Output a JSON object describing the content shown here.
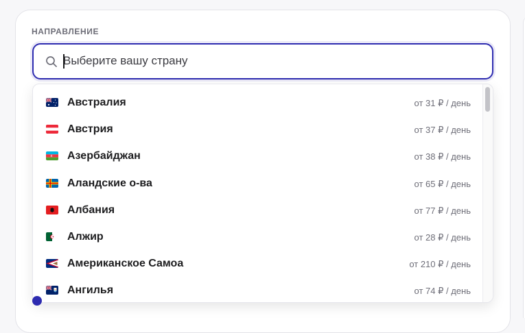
{
  "section": {
    "label": "НАПРАВЛЕНИЕ"
  },
  "search": {
    "placeholder": "Выберите вашу страну",
    "value": ""
  },
  "countries": [
    {
      "name": "Австралия",
      "price": "от 31 ₽ / день",
      "flag_icon": "flag-australia-icon"
    },
    {
      "name": "Австрия",
      "price": "от 37 ₽ / день",
      "flag_icon": "flag-austria-icon"
    },
    {
      "name": "Азербайджан",
      "price": "от 38 ₽ / день",
      "flag_icon": "flag-azerbaijan-icon"
    },
    {
      "name": "Аландские о-ва",
      "price": "от 65 ₽ / день",
      "flag_icon": "flag-aland-islands-icon"
    },
    {
      "name": "Албания",
      "price": "от 77 ₽ / день",
      "flag_icon": "flag-albania-icon"
    },
    {
      "name": "Алжир",
      "price": "от 28 ₽ / день",
      "flag_icon": "flag-algeria-icon"
    },
    {
      "name": "Американское Самоа",
      "price": "от 210 ₽ / день",
      "flag_icon": "flag-american-samoa-icon"
    },
    {
      "name": "Ангилья",
      "price": "от 74 ₽ / день",
      "flag_icon": "flag-anguilla-icon"
    }
  ],
  "colors": {
    "accent": "#2d2bb0",
    "muted_text": "#6e6e78",
    "primary_text": "#1c1c1e"
  }
}
